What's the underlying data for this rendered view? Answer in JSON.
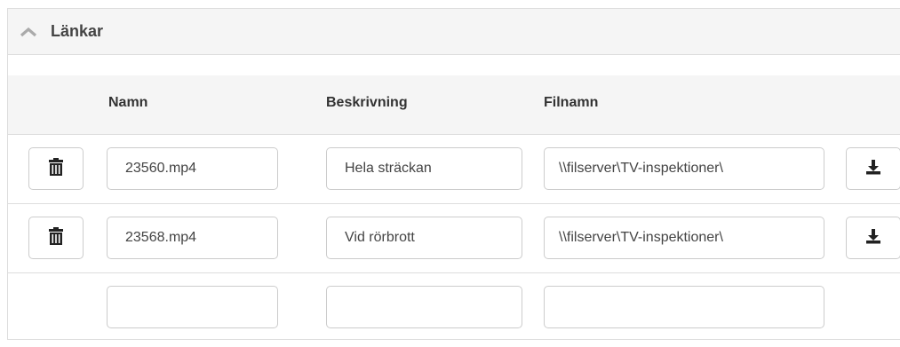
{
  "panel": {
    "title": "Länkar",
    "collapse_icon": "chevron-up-icon"
  },
  "table": {
    "columns": [
      "Namn",
      "Beskrivning",
      "Filnamn"
    ],
    "rows": [
      {
        "namn": "23560.mp4",
        "beskrivning": "Hela sträckan",
        "filnamn": "\\\\filserver\\TV-inspektioner\\",
        "delete_icon": "trash-icon",
        "download_icon": "download-icon"
      },
      {
        "namn": "23568.mp4",
        "beskrivning": "Vid rörbrott",
        "filnamn": "\\\\filserver\\TV-inspektioner\\",
        "delete_icon": "trash-icon",
        "download_icon": "download-icon"
      },
      {
        "namn": "",
        "beskrivning": "",
        "filnamn": ""
      }
    ]
  }
}
